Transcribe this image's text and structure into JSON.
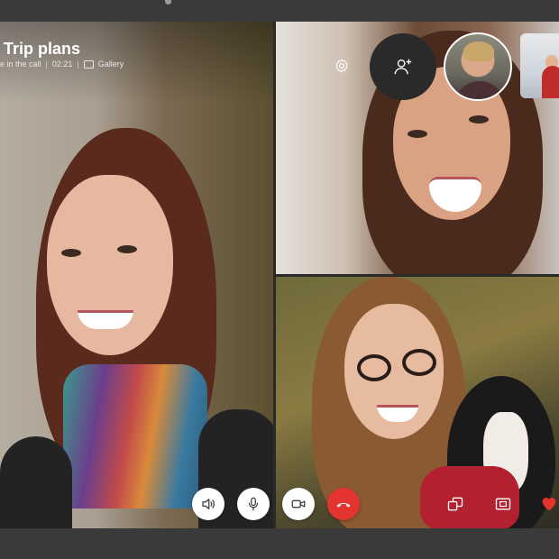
{
  "call": {
    "title": "Trip plans",
    "status": "e in the call",
    "duration": "02:21",
    "separator": "|",
    "view_mode": "Gallery"
  },
  "colors": {
    "hangup": "#e3342f",
    "reaction_heart": "#e3342f",
    "control_bg": "#ffffff",
    "window_chrome": "#3a3a3a"
  },
  "icons": {
    "settings": "gear-icon",
    "add_participant": "add-person-icon",
    "speaker": "speaker-icon",
    "microphone": "microphone-icon",
    "video": "video-camera-icon",
    "hangup": "phone-hangup-icon",
    "switch_camera": "switch-window-icon",
    "screen_share": "screen-share-icon",
    "reaction": "heart-icon",
    "gallery": "gallery-icon"
  }
}
